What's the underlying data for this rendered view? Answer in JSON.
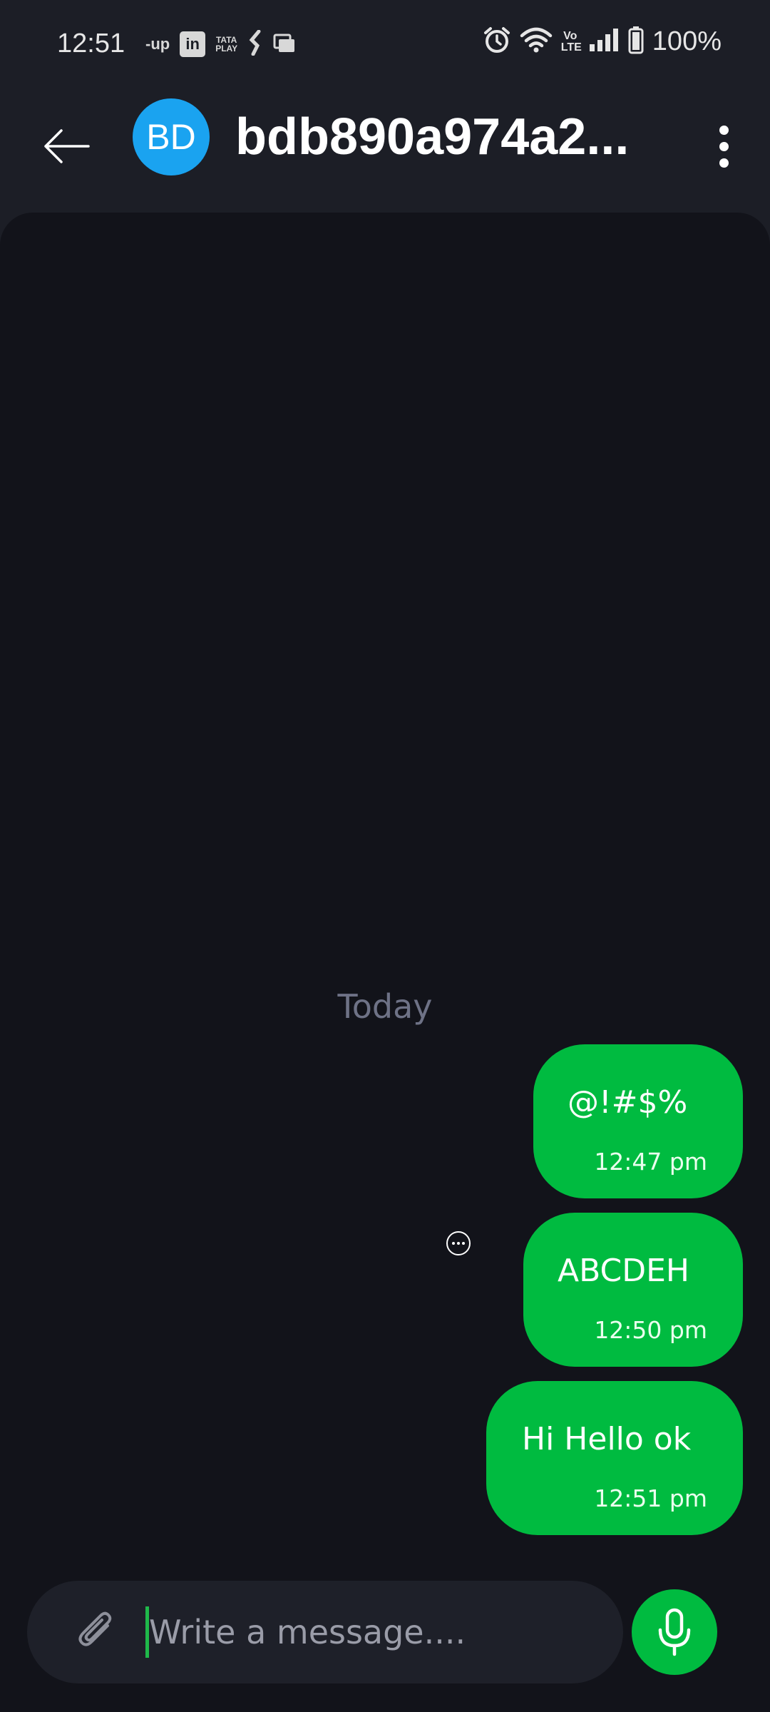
{
  "status_bar": {
    "time": "12:51",
    "notification_icons": [
      "up-app-icon",
      "linkedin-icon",
      "tata-play-icon",
      "kotak-icon",
      "gallery-icon"
    ],
    "notif_labels": {
      "up": "-up",
      "linkedin": "in",
      "tata_top": "TATA",
      "tata_bottom": "PLAY"
    },
    "right_icons": [
      "alarm-icon",
      "wifi-icon",
      "volte-icon",
      "signal-icon",
      "battery-icon"
    ],
    "volte_label": "Vo LTE",
    "battery": "100%"
  },
  "header": {
    "avatar_initials": "BD",
    "title": "bdb890a974a2...",
    "avatar_color": "#1aa3f0"
  },
  "chat": {
    "date_separator": "Today",
    "messages": [
      {
        "text": "@!#$%",
        "time": "12:47 pm",
        "outgoing": true
      },
      {
        "text": "ABCDEH",
        "time": "12:50 pm",
        "outgoing": true
      },
      {
        "text": "Hi Hello ok",
        "time": "12:51 pm",
        "outgoing": true
      }
    ],
    "bubble_color": "#00bb40"
  },
  "composer": {
    "placeholder": "Write a message....",
    "value": ""
  }
}
